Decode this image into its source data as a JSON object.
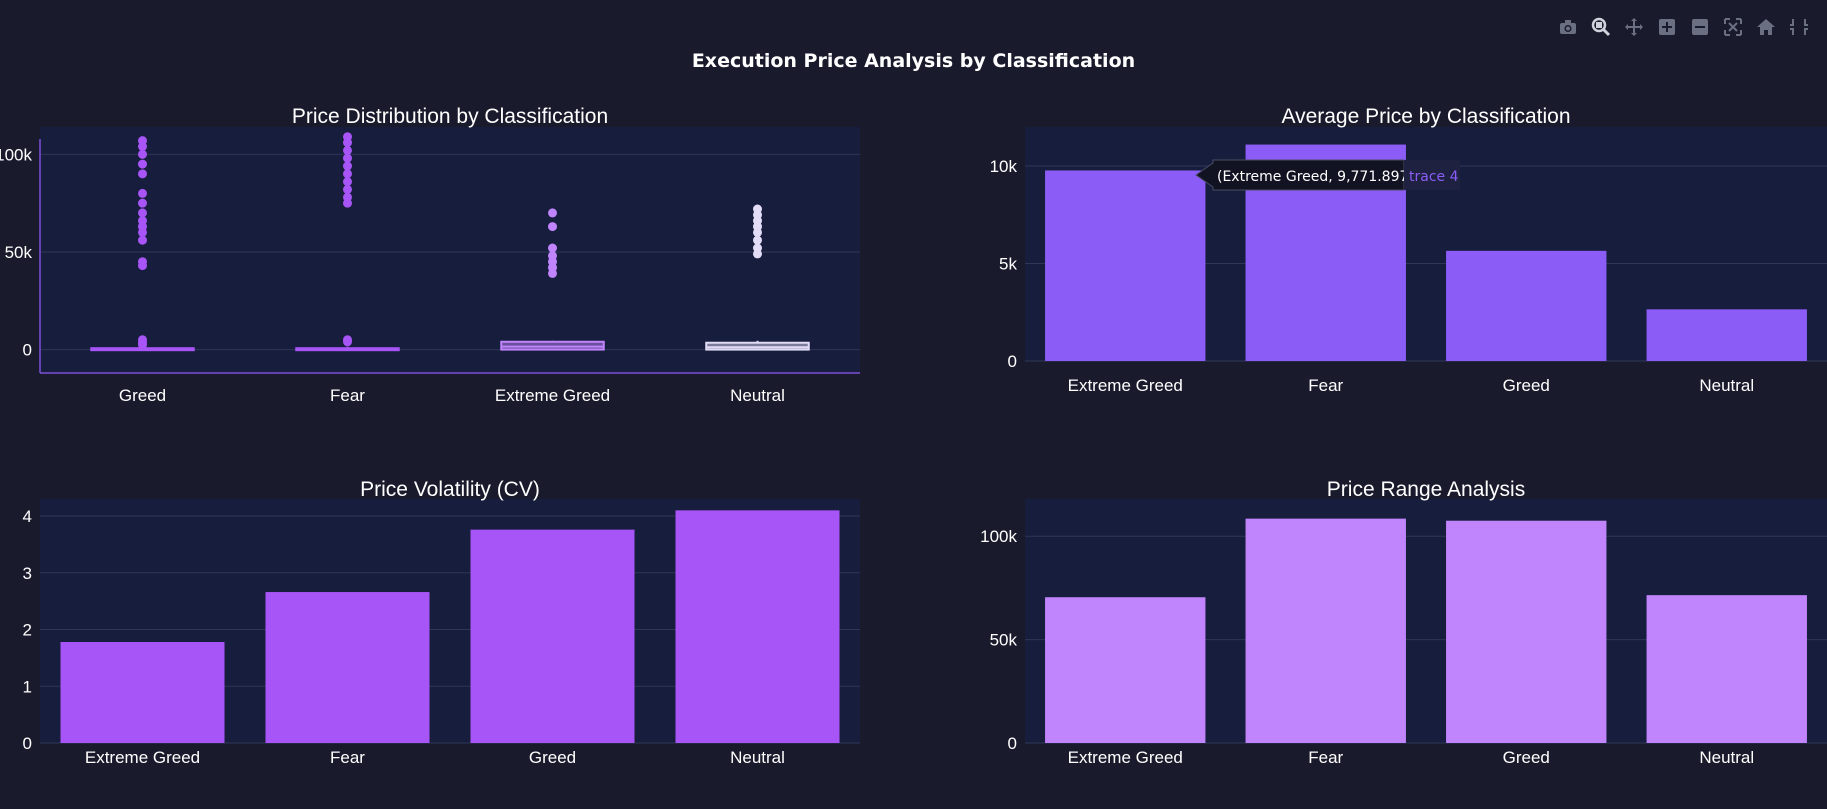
{
  "title": "Execution Price Analysis by Classification",
  "modebar": [
    {
      "name": "camera-icon",
      "label": "Download plot as a png"
    },
    {
      "name": "zoom-icon",
      "label": "Zoom"
    },
    {
      "name": "pan-icon",
      "label": "Pan"
    },
    {
      "name": "zoom-in-icon",
      "label": "Zoom in"
    },
    {
      "name": "zoom-out-icon",
      "label": "Zoom out"
    },
    {
      "name": "autoscale-icon",
      "label": "Autoscale"
    },
    {
      "name": "home-icon",
      "label": "Reset axes"
    },
    {
      "name": "spike-lines-icon",
      "label": "Toggle Spike Lines"
    }
  ],
  "colors": {
    "background": "#191a2c",
    "plot_bg": "#171d3d",
    "grid": "#2f3658",
    "box1": "#a855f7",
    "box_extreme": "#c084fc",
    "box_neutral": "#e2dcf7",
    "avg_bar": "#8b5cf6",
    "cv_bar": "#a855f7",
    "range_bar": "#c084fc"
  },
  "tooltip": {
    "text": "(Extreme Greed, 9,771.897)",
    "trace": "trace 4"
  },
  "chart_data": [
    {
      "type": "box",
      "title": "Price Distribution by Classification",
      "categories": [
        "Greed",
        "Fear",
        "Extreme Greed",
        "Neutral"
      ],
      "ylim": [
        -12000,
        114000
      ],
      "yticks": [
        0,
        50000,
        100000
      ],
      "ytick_labels": [
        "0",
        "50k",
        "100k"
      ],
      "series": [
        {
          "category": "Greed",
          "q1": 0,
          "median": 300,
          "q3": 700,
          "whisker_high": 1200,
          "outliers": [
            5000,
            3500,
            2500,
            43000,
            45000,
            56000,
            60000,
            63000,
            66000,
            70000,
            75000,
            80000,
            90000,
            95000,
            100000,
            104000,
            107000
          ]
        },
        {
          "category": "Fear",
          "q1": 0,
          "median": 300,
          "q3": 700,
          "whisker_high": 1500,
          "outliers": [
            5000,
            4000,
            75000,
            78000,
            82000,
            86000,
            90000,
            94000,
            98000,
            102000,
            106000,
            109000
          ]
        },
        {
          "category": "Extreme Greed",
          "q1": 0,
          "median": 1500,
          "q3": 4000,
          "whisker_high": 4500,
          "outliers": [
            39000,
            42000,
            45000,
            48000,
            52000,
            63000,
            70000
          ]
        },
        {
          "category": "Neutral",
          "q1": 0,
          "median": 1200,
          "q3": 3500,
          "whisker_high": 4500,
          "outliers": [
            49000,
            52000,
            56000,
            60000,
            63000,
            66000,
            69000,
            72000
          ]
        }
      ]
    },
    {
      "type": "bar",
      "title": "Average Price by Classification",
      "categories": [
        "Extreme Greed",
        "Fear",
        "Greed",
        "Neutral"
      ],
      "values": [
        9771.897,
        11100,
        5650,
        2650
      ],
      "ylim": [
        0,
        12000
      ],
      "yticks": [
        0,
        5000,
        10000
      ],
      "ytick_labels": [
        "0",
        "5k",
        "10k"
      ]
    },
    {
      "type": "bar",
      "title": "Price Volatility (CV)",
      "categories": [
        "Extreme Greed",
        "Fear",
        "Greed",
        "Neutral"
      ],
      "values": [
        1.78,
        2.66,
        3.76,
        4.1
      ],
      "ylim": [
        0,
        4.3
      ],
      "yticks": [
        0,
        1,
        2,
        3,
        4
      ],
      "ytick_labels": [
        "0",
        "1",
        "2",
        "3",
        "4"
      ]
    },
    {
      "type": "bar",
      "title": "Price Range Analysis",
      "categories": [
        "Extreme Greed",
        "Fear",
        "Greed",
        "Neutral"
      ],
      "values": [
        70500,
        108500,
        107500,
        71500
      ],
      "ylim": [
        0,
        118000
      ],
      "yticks": [
        0,
        50000,
        100000
      ],
      "ytick_labels": [
        "0",
        "50k",
        "100k"
      ]
    }
  ]
}
